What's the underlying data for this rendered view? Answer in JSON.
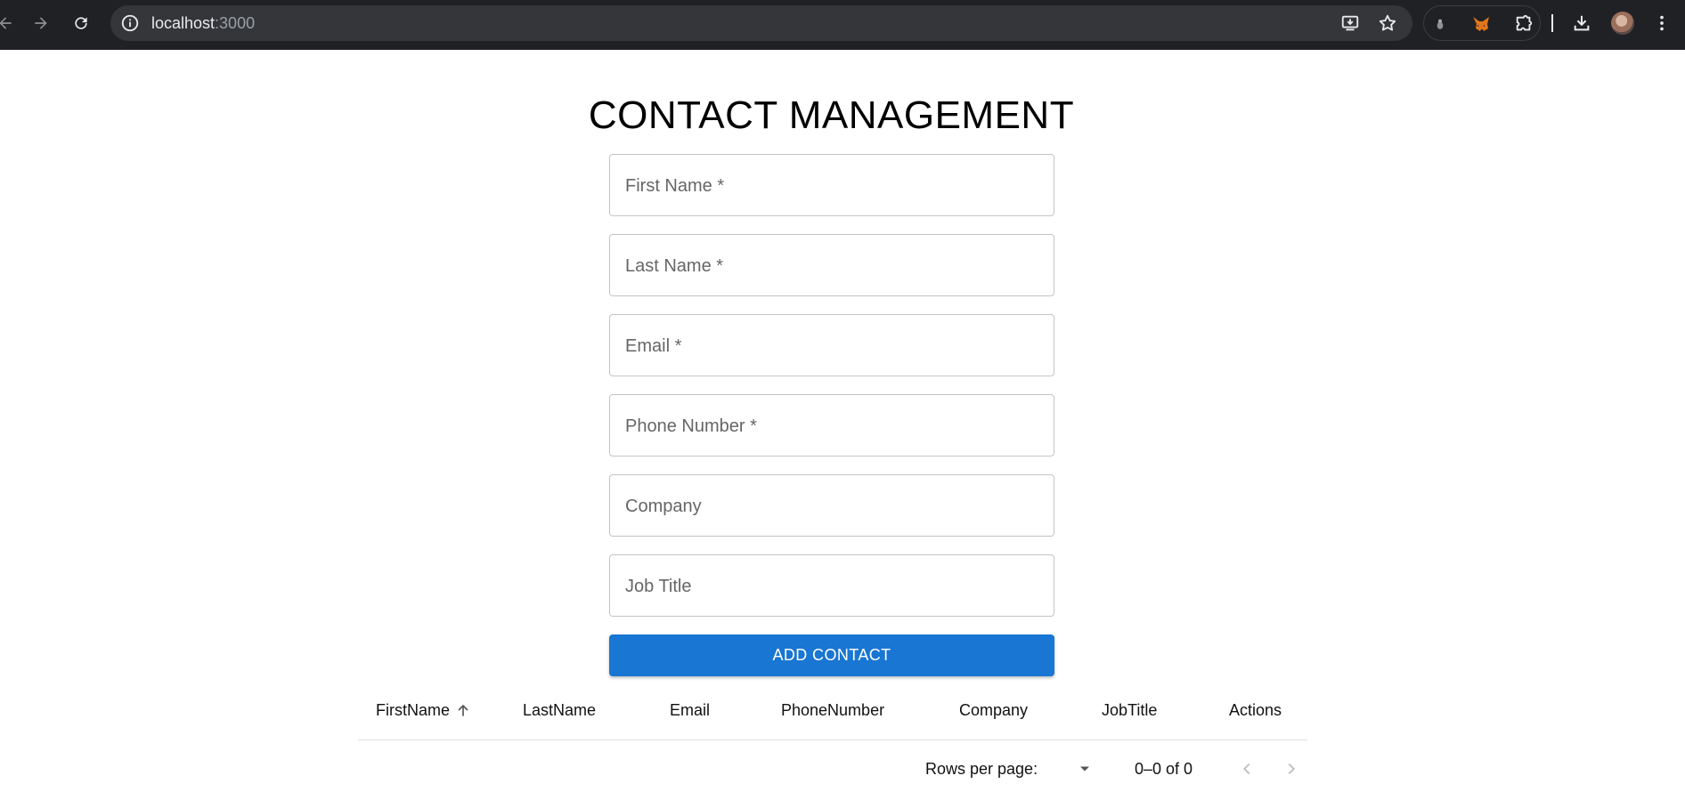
{
  "browser": {
    "url_host": "localhost",
    "url_port": ":3000",
    "icons": [
      "back-icon",
      "forward-icon",
      "reload-icon",
      "site-info-icon",
      "install-app-icon",
      "bookmark-star-icon",
      "extension-icon",
      "metamask-fox-icon",
      "extensions-puzzle-icon",
      "download-icon",
      "profile-avatar",
      "menu-kebab-icon"
    ]
  },
  "page": {
    "title": "CONTACT MANAGEMENT"
  },
  "form": {
    "fields": [
      {
        "label": "First Name *",
        "value": ""
      },
      {
        "label": "Last Name *",
        "value": ""
      },
      {
        "label": "Email *",
        "value": ""
      },
      {
        "label": "Phone Number *",
        "value": ""
      },
      {
        "label": "Company",
        "value": ""
      },
      {
        "label": "Job Title",
        "value": ""
      }
    ],
    "submit_label": "ADD CONTACT"
  },
  "table": {
    "columns": [
      "FirstName",
      "LastName",
      "Email",
      "PhoneNumber",
      "Company",
      "JobTitle",
      "Actions"
    ],
    "sorted_column": "FirstName",
    "sort_direction": "ascending",
    "rows": []
  },
  "pagination": {
    "rows_per_page_label": "Rows per page:",
    "rows_per_page_value": "",
    "range_text": "0–0 of 0"
  },
  "colors": {
    "primary": "#1976d2",
    "chrome_bg": "#202124",
    "omnibox_bg": "#35363a"
  }
}
